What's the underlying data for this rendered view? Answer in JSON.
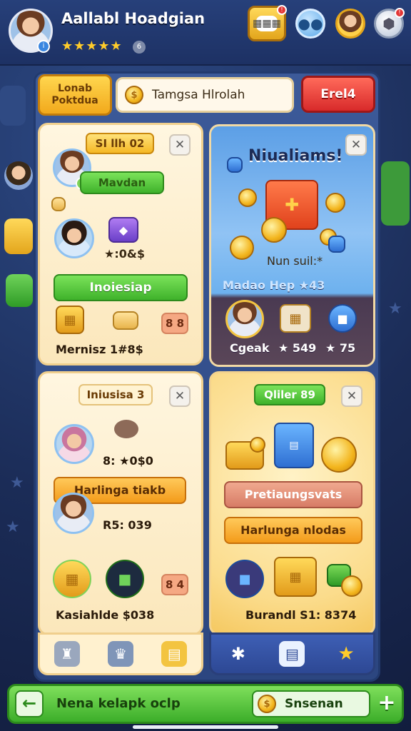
{
  "header": {
    "title": "Aallabl Hoadgian",
    "stars": "★★★★★",
    "level_chip": "6",
    "gift_label": "▦▦▦",
    "colors": {
      "accent": "#ffcc2a",
      "header_bg": "#27407a"
    }
  },
  "tabs": {
    "left_tab": "Lonab Poktdua",
    "search_text": "Tamgsa Hlrolah",
    "red_button": "Erel4"
  },
  "card1": {
    "label": "SI llh 02",
    "name_button": "Mavdan",
    "star_value": "★:0&$",
    "green_button": "Inoiesiap",
    "number_pill": "8 8",
    "footer_text": "Mernisz 1#8$"
  },
  "card2": {
    "title": "Niualiams!",
    "subtitle": "Nun suil:*",
    "row_label": "Madao Hep ★43",
    "avatar_name": "Cgeak",
    "stat1": "★ 549",
    "stat2": "★ 75"
  },
  "card3": {
    "label": "Iniusisa 3",
    "value1": "8: ★0$0",
    "orange_button": "Harlinga tiakb",
    "value2": "R5: 039",
    "number_pill": "8 4",
    "footer_text": "Kasiahlde $038"
  },
  "card4": {
    "label": "Qliler 89",
    "rose_button": "Pretiaungsvats",
    "orange_button": "Harlunga nlodas",
    "footer_text": "Burandl S1: 8374"
  },
  "bottom": {
    "label": "Nena kelapk oclp",
    "pill_label": "Snsenan",
    "plus": "+"
  }
}
